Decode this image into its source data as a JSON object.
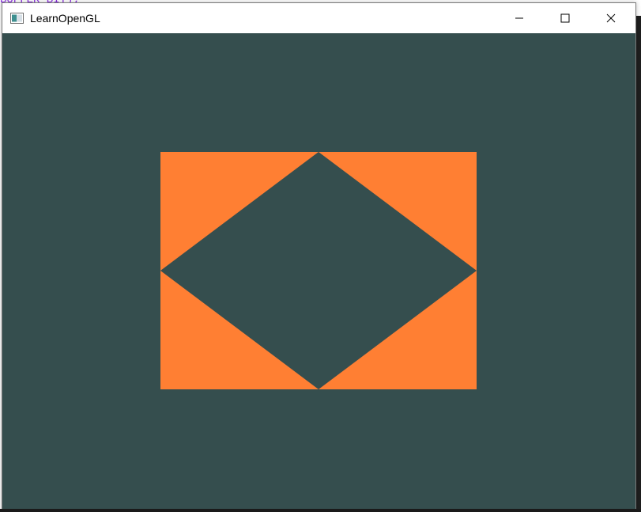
{
  "background_code": {
    "text": "BUFFER_BIT);"
  },
  "window": {
    "title": "LearnOpenGL",
    "app_icon": "opengl-window-icon",
    "controls": {
      "minimize": "minimize-icon",
      "maximize": "maximize-icon",
      "close": "close-icon"
    }
  },
  "scene": {
    "clear_color": "#354e4e",
    "shape_color": "#ff7f33",
    "shapes": [
      {
        "name": "top-left-triangle"
      },
      {
        "name": "top-right-triangle"
      },
      {
        "name": "bottom-left-triangle"
      },
      {
        "name": "bottom-right-triangle"
      }
    ]
  }
}
